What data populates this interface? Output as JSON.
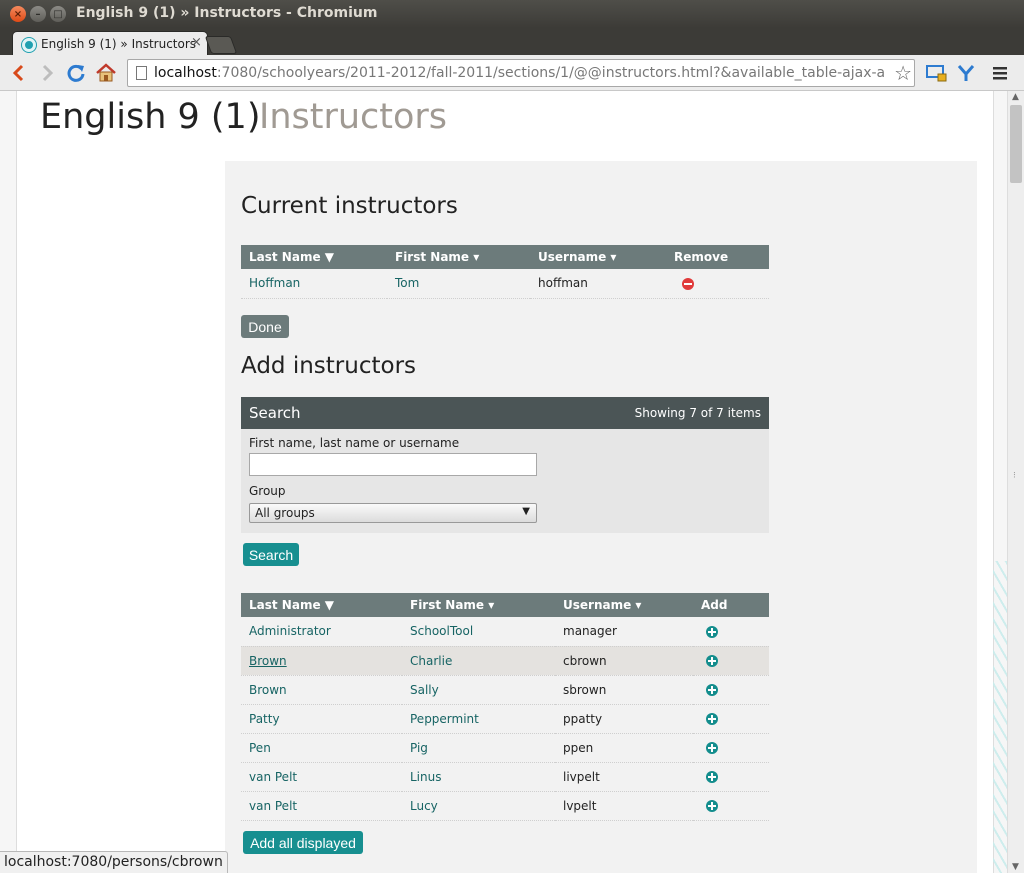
{
  "window": {
    "title": "English 9 (1) » Instructors - Chromium"
  },
  "tab": {
    "label": "English 9 (1) » Instructors",
    "close": "×"
  },
  "toolbar": {
    "url_host": "localhost",
    "url_rest": ":7080/schoolyears/2011-2012/fall-2011/sections/1/@@instructors.html?&available_table-ajax-availab"
  },
  "page": {
    "title": "English 9 (1)",
    "subtitle": "Instructors"
  },
  "current": {
    "heading": "Current instructors",
    "columns": [
      "Last Name ▼",
      "First Name ▾",
      "Username ▾",
      "Remove"
    ],
    "rows": [
      {
        "last": "Hoffman",
        "first": "Tom",
        "username": "hoffman"
      }
    ],
    "done_label": "Done"
  },
  "add": {
    "heading": "Add instructors",
    "search": {
      "title": "Search",
      "count": "Showing 7 of 7 items",
      "name_label": "First name, last name or username",
      "name_value": "",
      "group_label": "Group",
      "group_value": "All groups",
      "button": "Search"
    },
    "columns": [
      "Last Name ▼",
      "First Name ▾",
      "Username ▾",
      "Add"
    ],
    "rows": [
      {
        "last": "Administrator",
        "first": "SchoolTool",
        "username": "manager"
      },
      {
        "last": "Brown",
        "first": "Charlie",
        "username": "cbrown"
      },
      {
        "last": "Brown",
        "first": "Sally",
        "username": "sbrown"
      },
      {
        "last": "Patty",
        "first": "Peppermint",
        "username": "ppatty"
      },
      {
        "last": "Pen",
        "first": "Pig",
        "username": "ppen"
      },
      {
        "last": "van Pelt",
        "first": "Linus",
        "username": "livpelt"
      },
      {
        "last": "van Pelt",
        "first": "Lucy",
        "username": "lvpelt"
      }
    ],
    "add_all_label": "Add all displayed"
  },
  "status": {
    "text": "localhost:7080/persons/cbrown"
  },
  "icons": {
    "back": "back-arrow-icon",
    "forward": "forward-arrow-icon",
    "reload": "reload-icon",
    "home": "home-icon",
    "star": "star-icon",
    "remove": "remove-icon",
    "add": "add-icon"
  },
  "colors": {
    "header": "#6c7b7b",
    "link": "#176464",
    "accent": "#178f90",
    "remove": "#e03a3a"
  }
}
